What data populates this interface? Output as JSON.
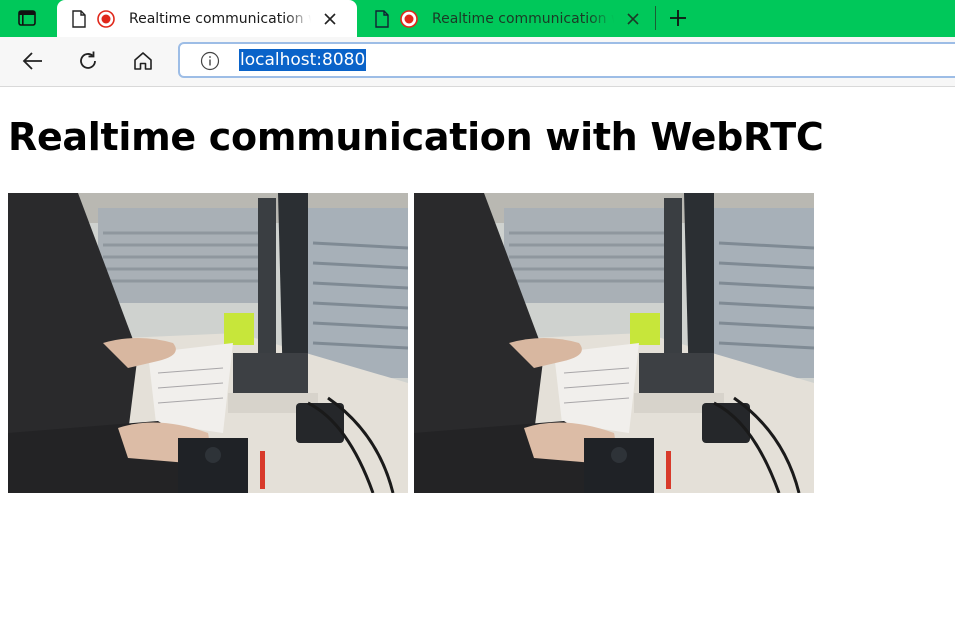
{
  "browser": {
    "tabs": [
      {
        "title": "Realtime communication with WebRTC",
        "active": true
      },
      {
        "title": "Realtime communication with WebRTC",
        "active": false
      }
    ],
    "address": {
      "url": "localhost:8080"
    },
    "colors": {
      "tabstrip": "#00c85a",
      "selection": "#0a63c9",
      "recording": "#e0271a"
    }
  },
  "page": {
    "heading": "Realtime communication with WebRTC",
    "videos": [
      {
        "name": "local-video"
      },
      {
        "name": "remote-video"
      }
    ]
  }
}
